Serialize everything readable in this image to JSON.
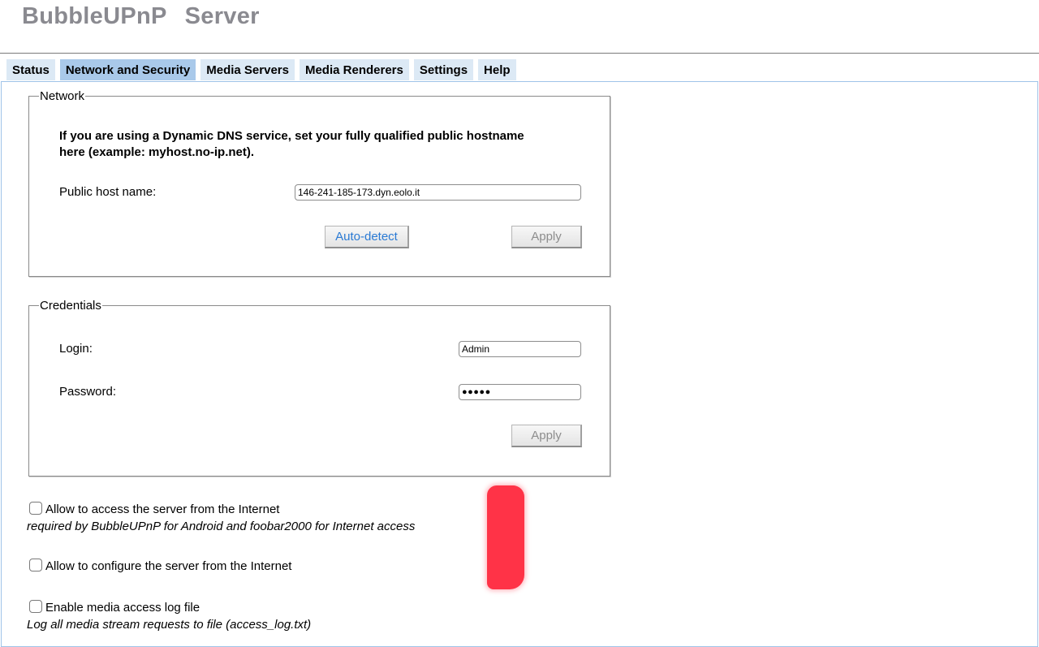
{
  "app": {
    "title_part1": "BubbleUPnP",
    "title_part2": "Server"
  },
  "tabs": [
    {
      "label": "Status",
      "active": false
    },
    {
      "label": "Network and Security",
      "active": true
    },
    {
      "label": "Media Servers",
      "active": false
    },
    {
      "label": "Media Renderers",
      "active": false
    },
    {
      "label": "Settings",
      "active": false
    },
    {
      "label": "Help",
      "active": false
    }
  ],
  "network": {
    "legend": "Network",
    "instruction_line1": "If you are using a Dynamic DNS service, set your fully qualified public hostname",
    "instruction_line2": "here (example: myhost.no-ip.net).",
    "host_label": "Public host name:",
    "host_value": "146-241-185-173.dyn.eolo.it",
    "auto_detect_label": "Auto-detect",
    "apply_label": "Apply"
  },
  "credentials": {
    "legend": "Credentials",
    "login_label": "Login:",
    "login_value": "Admin",
    "password_label": "Password:",
    "password_value": "●●●●●",
    "apply_label": "Apply"
  },
  "options": {
    "internet_access_label": "Allow to access the server from the Internet",
    "internet_access_note": "required by BubbleUPnP for Android and foobar2000 for Internet access",
    "internet_access_checked": false,
    "internet_config_label": "Allow to configure the server from the Internet",
    "internet_config_checked": false,
    "access_log_label": "Enable media access log file",
    "access_log_note": "Log all media stream requests to file (access_log.txt)",
    "access_log_checked": false
  },
  "colors": {
    "tab_background": "#dce9f5",
    "tab_active": "#a9c9ea",
    "link_blue": "#2a7ad4",
    "redaction": "#ff3347"
  }
}
